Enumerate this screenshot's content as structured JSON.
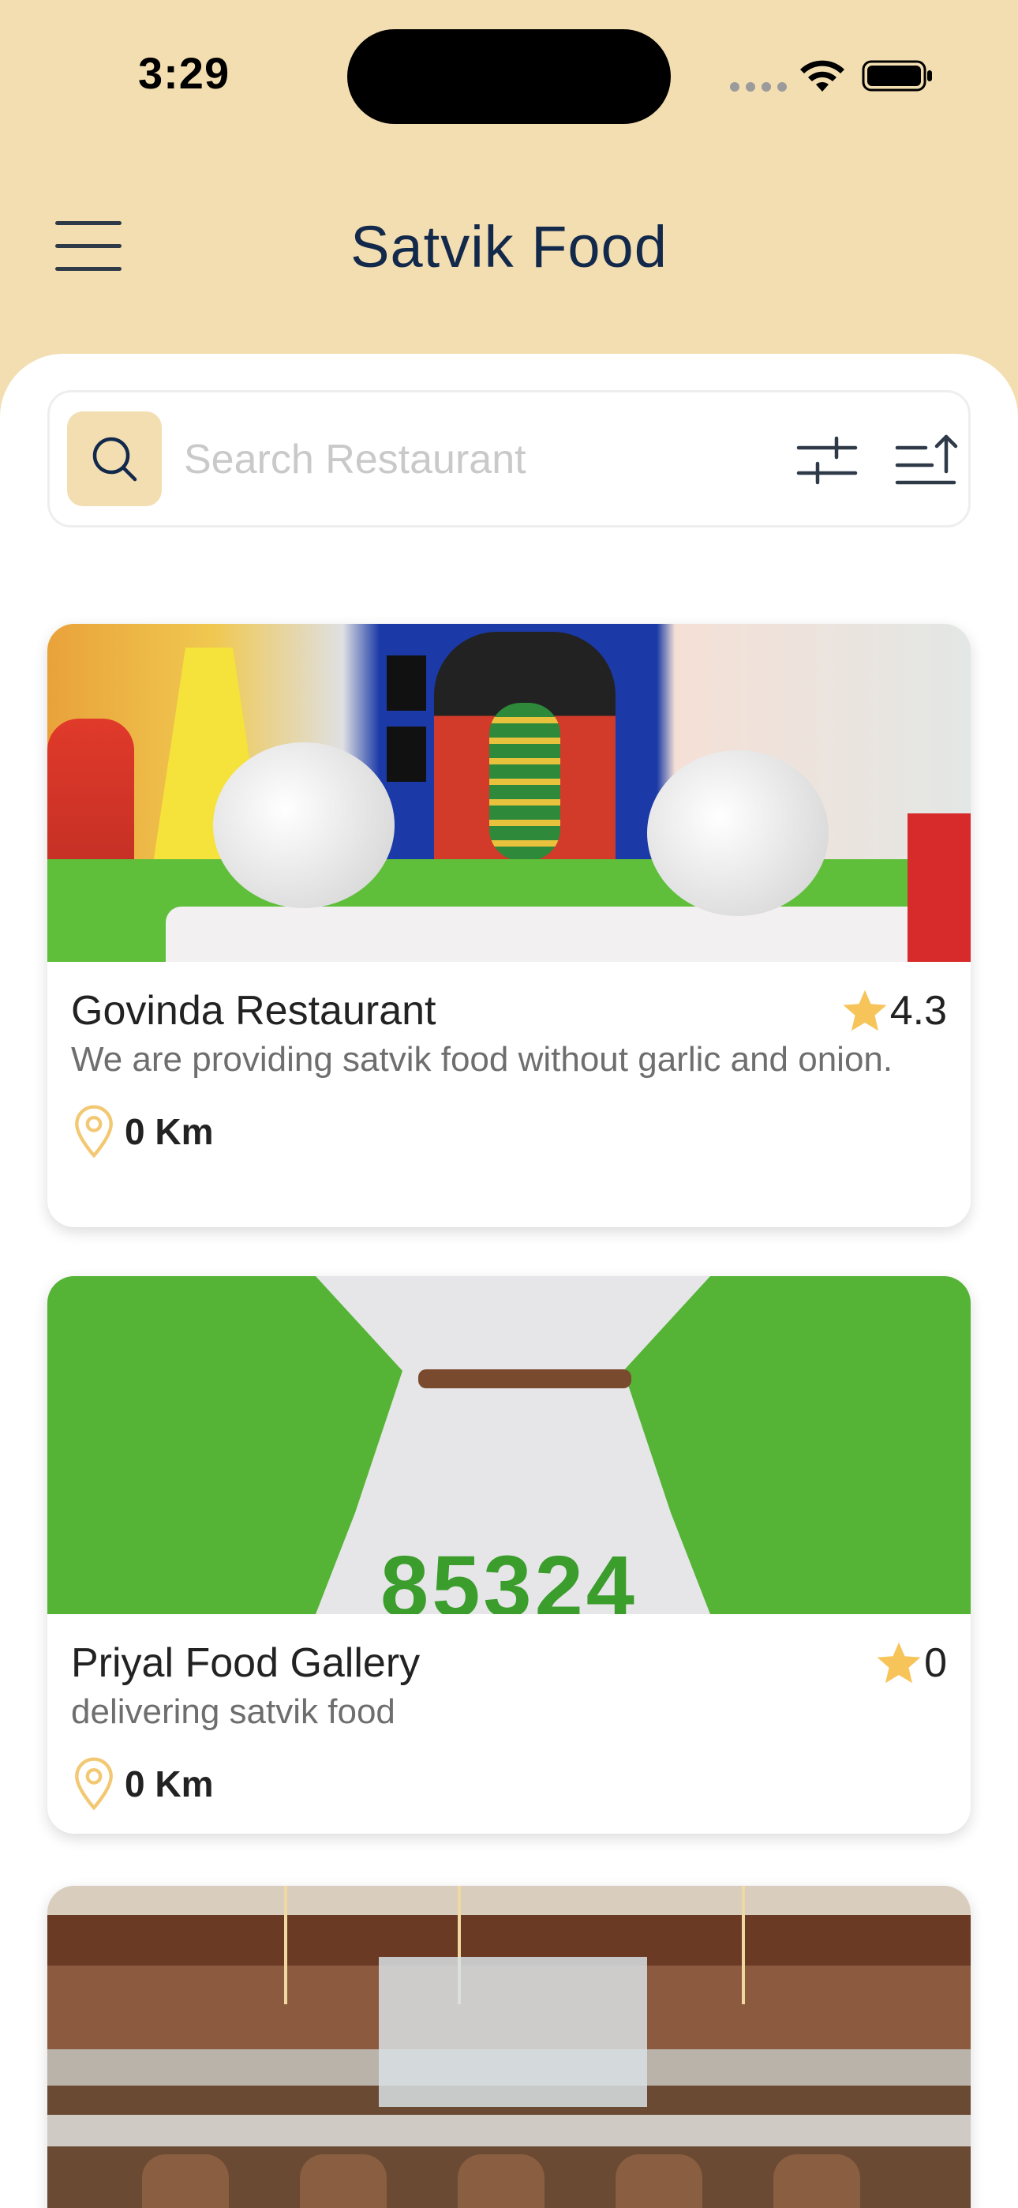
{
  "status_bar": {
    "time": "3:29"
  },
  "header": {
    "title": "Satvik Food"
  },
  "search": {
    "placeholder": "Search Restaurant"
  },
  "restaurants": [
    {
      "name": "Govinda Restaurant",
      "description": "We are providing satvik food without garlic and onion.",
      "rating": "4.3",
      "distance": "0 Km"
    },
    {
      "name": "Priyal Food Gallery",
      "description": "delivering satvik food",
      "rating": "0",
      "distance": "0 Km",
      "image_text": "85324"
    },
    {}
  ],
  "colors": {
    "header_bg": "#F3DEB1",
    "title": "#13294B",
    "star": "#F7C45A",
    "location_icon": "#F3C873"
  },
  "icons": [
    "menu-icon",
    "search-icon",
    "filter-icon",
    "sort-icon",
    "star-icon",
    "location-pin-icon"
  ]
}
